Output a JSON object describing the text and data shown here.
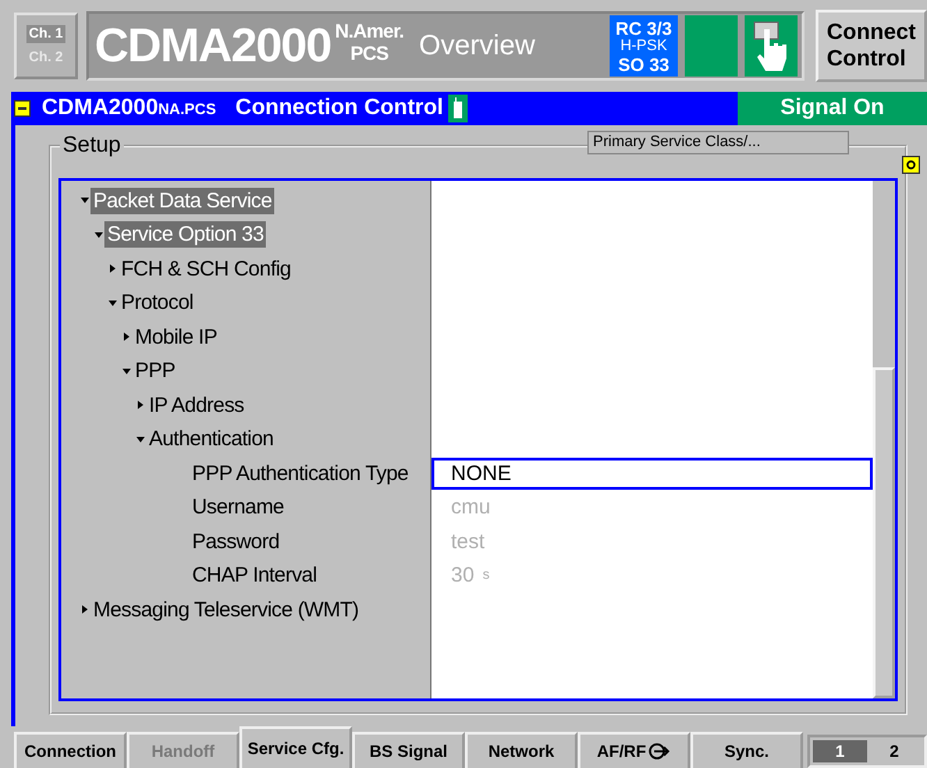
{
  "header": {
    "channels": [
      {
        "label": "Ch. 1",
        "selected": true
      },
      {
        "label": "Ch. 2",
        "selected": false
      }
    ],
    "title": "CDMA2000",
    "title_super": "N.Amer.",
    "title_sub": "PCS",
    "view": "Overview",
    "status": [
      "RC 3/3",
      "H-PSK",
      "SO 33"
    ],
    "connect_button": "Connect Control"
  },
  "subheader": {
    "title": "CDMA2000",
    "title_suffix": "NA.PCS",
    "section": "Connection Control",
    "signal": "Signal On"
  },
  "setup": {
    "label": "Setup",
    "hint": "Primary Service Class/...",
    "tree": [
      {
        "label": "Packet Data Service",
        "expanded": true,
        "selected": true,
        "children": [
          {
            "label": "Service Option 33",
            "expanded": true,
            "selected": true,
            "children": [
              {
                "label": "FCH & SCH Config",
                "expanded": false,
                "selected": false
              },
              {
                "label": "Protocol",
                "expanded": true,
                "selected": false,
                "children": [
                  {
                    "label": "Mobile IP",
                    "expanded": false,
                    "selected": false
                  },
                  {
                    "label": "PPP",
                    "expanded": true,
                    "selected": false,
                    "children": [
                      {
                        "label": "IP Address",
                        "expanded": false,
                        "selected": false
                      },
                      {
                        "label": "Authentication",
                        "expanded": true,
                        "selected": false,
                        "children": [
                          {
                            "label": "PPP Authentication Type",
                            "selected": false,
                            "value": "NONE",
                            "focused": true,
                            "disabled": false
                          },
                          {
                            "label": "Username",
                            "selected": false,
                            "value": "cmu",
                            "focused": false,
                            "disabled": true
                          },
                          {
                            "label": "Password",
                            "selected": false,
                            "value": "test",
                            "focused": false,
                            "disabled": true
                          },
                          {
                            "label": "CHAP Interval",
                            "selected": false,
                            "value": "30",
                            "unit": "s",
                            "focused": false,
                            "disabled": true
                          }
                        ]
                      }
                    ]
                  }
                ]
              }
            ]
          }
        ]
      },
      {
        "label": "Messaging Teleservice (WMT)",
        "expanded": false,
        "selected": false
      }
    ]
  },
  "tabs": [
    {
      "label": "Connection",
      "selected": false,
      "disabled": false
    },
    {
      "label": "Handoff",
      "selected": false,
      "disabled": true
    },
    {
      "label": "Service Cfg.",
      "selected": true,
      "disabled": false
    },
    {
      "label": "BS Signal",
      "selected": false,
      "disabled": false
    },
    {
      "label": "Network",
      "selected": false,
      "disabled": false
    },
    {
      "label": "AF/RF",
      "selected": false,
      "disabled": false,
      "icon": true
    },
    {
      "label": "Sync.",
      "selected": false,
      "disabled": false
    }
  ],
  "pages": [
    {
      "label": "1",
      "selected": true
    },
    {
      "label": "2",
      "selected": false
    }
  ]
}
